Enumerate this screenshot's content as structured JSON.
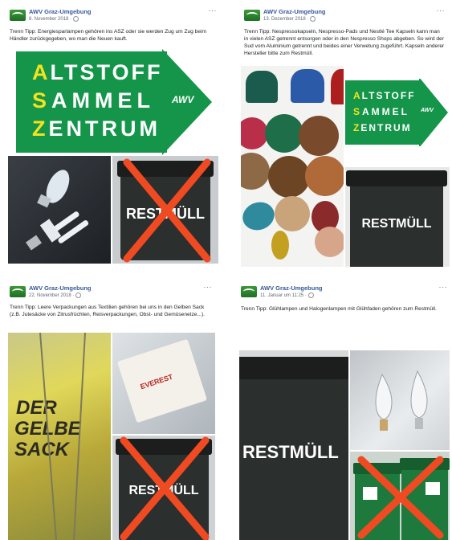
{
  "posts": [
    {
      "page_name": "AWV Graz-Umgebung",
      "date": "8. November 2018 ·",
      "more": "···",
      "text": "Trenn Tipp: Energiesparlampen gehören ins ASZ oder sie werden Zug um Zug beim Händler zurückgegeben, wo man die Neuen kauft.",
      "sign": {
        "line1_first": "A",
        "line1_rest": "LTSTOFF",
        "line2_first": "S",
        "line2_rest": "AMMEL",
        "line3_first": "Z",
        "line3_rest": "ENTRUM",
        "logo": "AWV"
      },
      "bin_label": "RESTMÜLL"
    },
    {
      "page_name": "AWV Graz-Umgebung",
      "date": "13. Dezember 2018 ·",
      "more": "···",
      "text": "Trenn Tipp: Nespressokapseln, Nespresso-Pads und Nestlé Tee Kapseln kann man in vielen ASZ getrennt entsorgen oder in den Nespresso Shops abgeben. So wird der Sud vom Aluminium getrennt und beides einer Verwetung zugeführt. Kapseln anderer Hersteller bitte zum Restmüll.",
      "sign": {
        "line1_first": "A",
        "line1_rest": "LTSTOFF",
        "line2_first": "S",
        "line2_rest": "AMMEL",
        "line3_first": "Z",
        "line3_rest": "ENTRUM",
        "logo": "AWV"
      },
      "bin_label": "RESTMÜLL"
    },
    {
      "page_name": "AWV Graz-Umgebung",
      "date": "22. November 2018 ·",
      "more": "···",
      "text": "Trenn Tipp: Leere Verpackungen aus Textilien gehören bei uns in den Gelben Sack (z.B. Jutesäcke von Zitrusfrüchten, Reisverpackungen, Obst- und Gemüsenetze...).",
      "sack_lines": [
        "DER",
        "GELBE",
        "SACK"
      ],
      "everest_label": "EVEREST",
      "bin_label": "RESTMÜLL"
    },
    {
      "page_name": "AWV Graz-Umgebung",
      "date": "11. Januar um 11:25 ·",
      "more": "···",
      "text": "Trenn Tipp: Glühlampen und Halogenlampen mit Glühfaden gehören zum Restmüll.",
      "bin_label": "RESTMÜLL"
    }
  ],
  "colors": {
    "sign_green": "#14954a",
    "sign_yellow": "#f4e21f",
    "cross_red": "#f04a22",
    "link_blue": "#385898"
  },
  "icons": [
    "page-logo-icon",
    "globe-icon",
    "more-options-icon",
    "red-cross-icon"
  ]
}
